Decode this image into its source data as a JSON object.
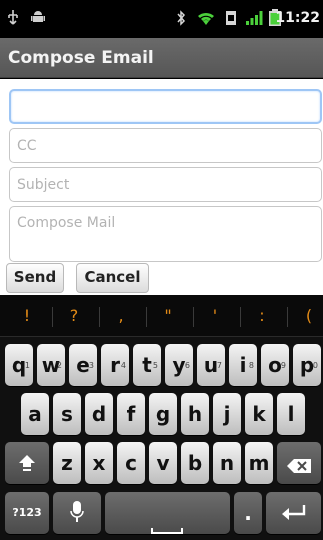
{
  "statusbar": {
    "usb_icon": "usb-icon",
    "android_icon": "android-debug-icon",
    "bluetooth_icon": "bluetooth-icon",
    "wifi_icon": "wifi-icon",
    "sim_icon": "sim-icon",
    "signal_icon": "signal-icon",
    "battery_icon": "battery-icon",
    "time": "11:22"
  },
  "titlebar": {
    "title": "Compose Email"
  },
  "form": {
    "to_value": "",
    "to_placeholder": "",
    "cc_placeholder": "CC",
    "subject_placeholder": "Subject",
    "body_placeholder": "Compose Mail"
  },
  "buttons": {
    "send": "Send",
    "cancel": "Cancel"
  },
  "suggestions": [
    "!",
    "?",
    ",",
    "\"",
    "'",
    ":",
    "("
  ],
  "keyboard": {
    "row1": [
      {
        "label": "q",
        "num": "1"
      },
      {
        "label": "w",
        "num": "2"
      },
      {
        "label": "e",
        "num": "3"
      },
      {
        "label": "r",
        "num": "4"
      },
      {
        "label": "t",
        "num": "5"
      },
      {
        "label": "y",
        "num": "6"
      },
      {
        "label": "u",
        "num": "7"
      },
      {
        "label": "i",
        "num": "8"
      },
      {
        "label": "o",
        "num": "9"
      },
      {
        "label": "p",
        "num": "0"
      }
    ],
    "row2": [
      "a",
      "s",
      "d",
      "f",
      "g",
      "h",
      "j",
      "k",
      "l"
    ],
    "row3": [
      "z",
      "x",
      "c",
      "v",
      "b",
      "n",
      "m"
    ],
    "shift_icon": "shift-icon",
    "backspace_icon": "backspace-icon",
    "symbols_label": "?123",
    "mic_icon": "microphone-icon",
    "space_icon": "space-icon",
    "period_label": ".",
    "enter_icon": "enter-icon"
  },
  "colors": {
    "statusbar_bg": "#000000",
    "titlebar_bg": "#5f5f5f",
    "accent_suggestion": "#e38b17",
    "field_focus": "#9ec6f5"
  }
}
